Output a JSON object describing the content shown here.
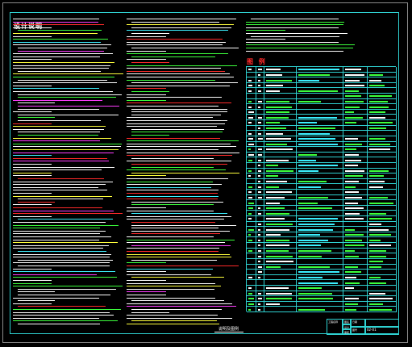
{
  "drawing": {
    "design_title": "设计说明",
    "legend_title": "图 例",
    "sheet_name": "说明及图例"
  },
  "title_block": {
    "labels": [
      "工程名称",
      "图名",
      "设计",
      "审核",
      "日期",
      "图号"
    ],
    "values": [
      "",
      "",
      "",
      "",
      "",
      "02-01"
    ]
  },
  "colors": {
    "background": "#000000",
    "frame": "#2fd2d2",
    "text_white": "#ffffff",
    "text_green": "#3cff3c",
    "text_red": "#ff2a2a",
    "text_magenta": "#ff3cff",
    "text_yellow": "#ffff3c",
    "text_cyan": "#3cf0ff"
  }
}
